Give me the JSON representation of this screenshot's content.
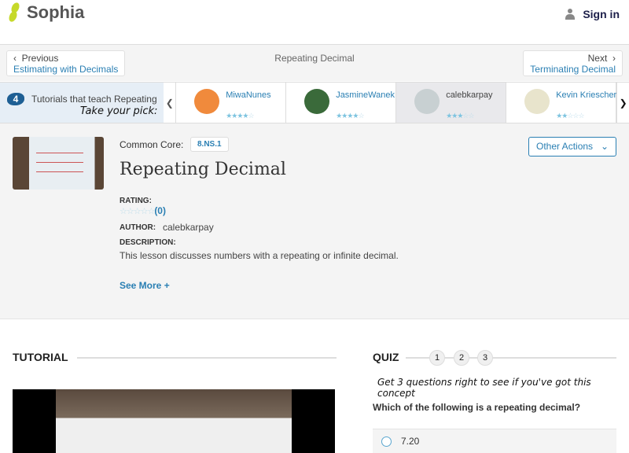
{
  "header": {
    "logo": "Sophia",
    "signin": "Sign in"
  },
  "nav": {
    "prev_label": "Previous",
    "prev_link": "Estimating with Decimals",
    "title": "Repeating Decimal",
    "next_label": "Next",
    "next_link": "Terminating Decimal"
  },
  "carousel": {
    "count": "4",
    "intro": "Tutorials that teach Repeating Decimal",
    "pick": "Take your pick:",
    "tutors": [
      {
        "name": "MiwaNunes",
        "rating": 4,
        "color": "#f08a3c"
      },
      {
        "name": "JasmineWanek",
        "rating": 3.5,
        "color": "#3a6a3a"
      },
      {
        "name": "calebkarpay",
        "rating": 3,
        "color": "#c8d0d2"
      },
      {
        "name": "Kevin Kriescher",
        "rating": 2,
        "color": "#e8e4cc"
      }
    ]
  },
  "lesson": {
    "cc_label": "Common Core:",
    "cc_tag": "8.NS.1",
    "title": "Repeating Decimal",
    "other_actions": "Other Actions",
    "rating_label": "RATING:",
    "rating_count": "(0)",
    "rating": 0,
    "author_label": "AUTHOR:",
    "author": "calebkarpay",
    "description_label": "DESCRIPTION:",
    "description": "This lesson discusses numbers with a repeating or infinite decimal.",
    "see_more": "See More +"
  },
  "tutorial": {
    "heading": "TUTORIAL"
  },
  "quiz": {
    "heading": "QUIZ",
    "steps": [
      "1",
      "2",
      "3"
    ],
    "hint": "Get 3 questions right to see if you've got this concept",
    "question": "Which of the following is a repeating decimal?",
    "options": [
      "7.20"
    ]
  },
  "colors": {
    "brand": "#c6d92a",
    "link": "#2a7fb3"
  }
}
